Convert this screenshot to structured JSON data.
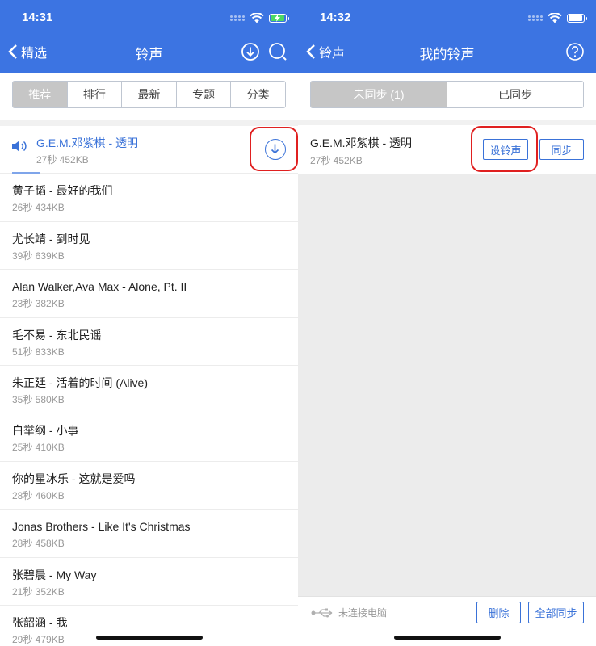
{
  "colors": {
    "brand_blue": "#3c74e2",
    "accent_red": "#e02020",
    "link_blue": "#3a72d8"
  },
  "left_screen": {
    "status_bar": {
      "time": "14:31",
      "battery": "charging"
    },
    "nav": {
      "back_label": "精选",
      "title": "铃声",
      "icons": [
        "download-icon",
        "search-icon"
      ]
    },
    "tabs": [
      {
        "label": "推荐",
        "active": true
      },
      {
        "label": "排行",
        "active": false
      },
      {
        "label": "最新",
        "active": false
      },
      {
        "label": "专题",
        "active": false
      },
      {
        "label": "分类",
        "active": false
      }
    ],
    "songs": [
      {
        "title": "G.E.M.邓紫棋 - 透明",
        "meta": "27秒  452KB",
        "playing": true
      },
      {
        "title": "黄子韬 - 最好的我们",
        "meta": "26秒  434KB"
      },
      {
        "title": "尤长靖 - 到时见",
        "meta": "39秒  639KB"
      },
      {
        "title": "Alan Walker,Ava Max - Alone, Pt. II",
        "meta": "23秒  382KB"
      },
      {
        "title": "毛不易 - 东北民谣",
        "meta": "51秒  833KB"
      },
      {
        "title": "朱正廷 - 活着的时间 (Alive)",
        "meta": "35秒  580KB"
      },
      {
        "title": "白举纲 - 小事",
        "meta": "25秒  410KB"
      },
      {
        "title": "你的星冰乐 - 这就是爱吗",
        "meta": "28秒  460KB"
      },
      {
        "title": "Jonas Brothers - Like It's Christmas",
        "meta": "28秒  458KB"
      },
      {
        "title": "张碧晨 - My Way",
        "meta": "21秒  352KB"
      },
      {
        "title": "张韶涵 - 我",
        "meta": "29秒  479KB"
      }
    ]
  },
  "right_screen": {
    "status_bar": {
      "time": "14:32",
      "battery": "full"
    },
    "nav": {
      "back_label": "铃声",
      "title": "我的铃声",
      "icons": [
        "help-icon"
      ]
    },
    "tabs": [
      {
        "label": "未同步 (1)",
        "active": true
      },
      {
        "label": "已同步",
        "active": false
      }
    ],
    "item": {
      "title": "G.E.M.邓紫棋 - 透明",
      "meta": "27秒  452KB",
      "set_label": "设铃声",
      "sync_label": "同步"
    },
    "bottom": {
      "status": "未连接电脑",
      "delete_label": "删除",
      "sync_all_label": "全部同步"
    }
  }
}
